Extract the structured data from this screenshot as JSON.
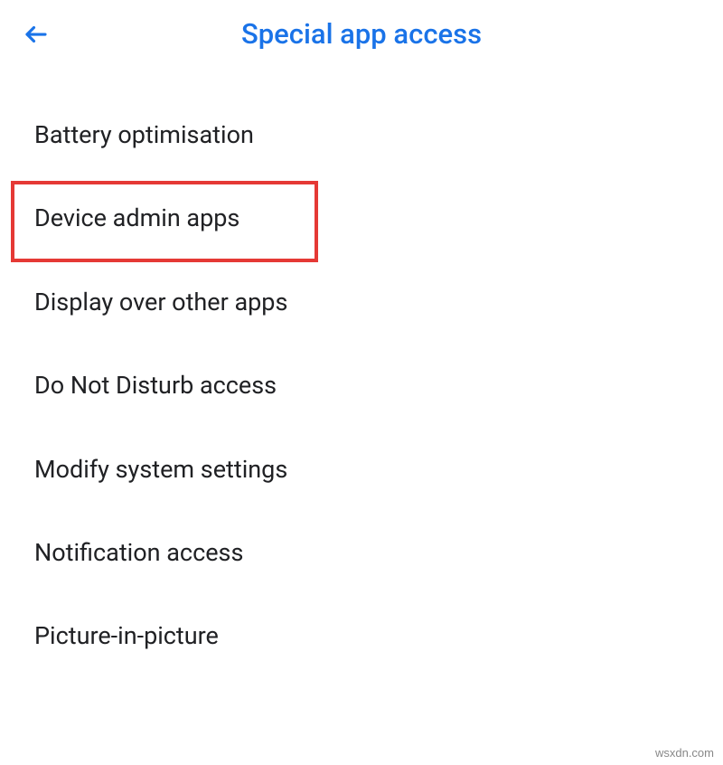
{
  "header": {
    "title": "Special app access",
    "accent_color": "#1a73e8"
  },
  "list": {
    "items": [
      {
        "label": "Battery optimisation"
      },
      {
        "label": "Device admin apps"
      },
      {
        "label": "Display over other apps"
      },
      {
        "label": "Do Not Disturb access"
      },
      {
        "label": "Modify system settings"
      },
      {
        "label": "Notification access"
      },
      {
        "label": "Picture-in-picture"
      }
    ]
  },
  "highlight": {
    "index": 1,
    "color": "#e53935"
  },
  "watermark": "wsxdn.com"
}
